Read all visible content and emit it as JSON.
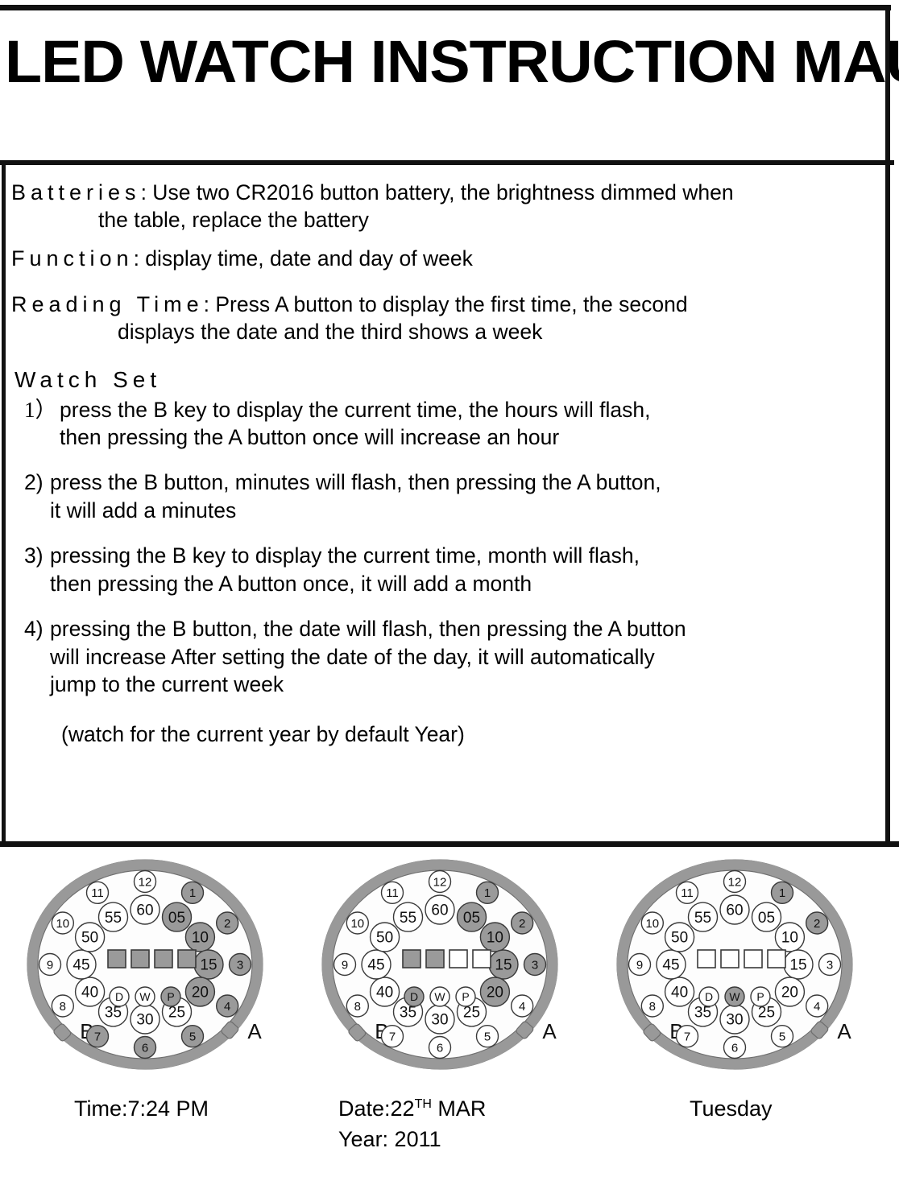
{
  "title": "LED WATCH INSTRUCTION MAUNAL",
  "sections": {
    "batteries": {
      "label": "Batteries",
      "colon": ":",
      "line1": " Use two CR2016 button battery, the brightness dimmed when",
      "line2": "the table, replace the battery"
    },
    "function": {
      "label": "Function",
      "colon": ":",
      "line1": " display time, date and day of week"
    },
    "reading_time": {
      "label": "Reading Time",
      "colon": ":",
      "line1": " Press A button to display the first time, the second",
      "line2": "displays the date and the third shows a week"
    },
    "watch_set": {
      "heading": "Watch Set",
      "steps": [
        {
          "num": "1）",
          "line1": "press the B key to display the current time, the hours will flash,",
          "line2": "then pressing the A button once will increase an hour"
        },
        {
          "num": "2)",
          "line1": "press the B button, minutes will flash, then pressing the A button,",
          "line2": "it will add a minutes"
        },
        {
          "num": "3)",
          "line1": "pressing the B key to display the current time, month will flash,",
          "line2": "then pressing the A button once, it will add a month"
        },
        {
          "num": "4)",
          "line1": "pressing the B button, the date will flash, then pressing the A button",
          "line2": "will increase After setting the date of the day, it will automatically",
          "line3": "jump to the current week"
        }
      ],
      "note": "(watch for the current year by default Year)"
    }
  },
  "colors": {
    "bezel": "#999999",
    "bezel_stroke": "#6e6e6e",
    "fill_on": "#9a9a9a",
    "fill_off": "#ffffff",
    "stroke": "#3a3a3a",
    "face": "#fdfdfd",
    "rule": "#111111"
  },
  "watch_common": {
    "hour_labels": [
      "1",
      "2",
      "3",
      "4",
      "5",
      "6",
      "7",
      "8",
      "9",
      "10",
      "11",
      "12"
    ],
    "minute_labels": [
      "05",
      "10",
      "15",
      "20",
      "25",
      "30",
      "35",
      "40",
      "45",
      "50",
      "55",
      "60"
    ],
    "mode_labels": [
      "D",
      "W",
      "P"
    ],
    "crowns": [
      "A",
      "B"
    ],
    "square_count": 4
  },
  "watches": [
    {
      "id": "watch-time",
      "caption_lines": [
        "Time:7:24 PM"
      ],
      "hours_on": [
        "1",
        "2",
        "3",
        "4",
        "5",
        "6",
        "7"
      ],
      "minutes_on": [
        "05",
        "10",
        "15",
        "20"
      ],
      "modes_on": [
        "P"
      ],
      "squares_on": [
        true,
        true,
        true,
        true
      ]
    },
    {
      "id": "watch-date",
      "caption_lines": [
        "Date:22",
        "Year: 2011"
      ],
      "caption_sup": "TH",
      "caption_tail": " MAR",
      "hours_on": [
        "1",
        "2",
        "3"
      ],
      "minutes_on": [
        "05",
        "10",
        "15",
        "20"
      ],
      "modes_on": [
        "D"
      ],
      "squares_on": [
        true,
        true,
        false,
        false
      ]
    },
    {
      "id": "watch-week",
      "caption_lines": [
        "Tuesday"
      ],
      "hours_on": [
        "1",
        "2"
      ],
      "minutes_on": [],
      "modes_on": [
        "W"
      ],
      "squares_on": [
        false,
        false,
        false,
        false
      ]
    }
  ]
}
